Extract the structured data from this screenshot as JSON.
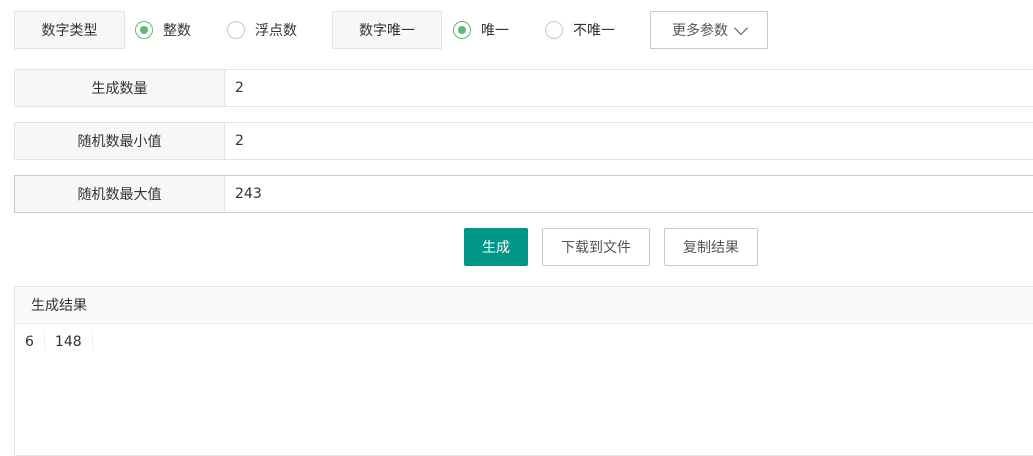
{
  "options": {
    "number_type": {
      "label": "数字类型",
      "choices": [
        {
          "label": "整数",
          "checked": true
        },
        {
          "label": "浮点数",
          "checked": false
        }
      ]
    },
    "unique": {
      "label": "数字唯一",
      "choices": [
        {
          "label": "唯一",
          "checked": true
        },
        {
          "label": "不唯一",
          "checked": false
        }
      ]
    },
    "more_params_label": "更多参数"
  },
  "form": {
    "count": {
      "label": "生成数量",
      "value": "2"
    },
    "min": {
      "label": "随机数最小值",
      "value": "2"
    },
    "max": {
      "label": "随机数最大值",
      "value": "243"
    }
  },
  "actions": {
    "generate_label": "生成",
    "download_label": "下载到文件",
    "copy_label": "复制结果"
  },
  "result": {
    "title": "生成结果",
    "values": [
      "6",
      "148"
    ]
  },
  "colors": {
    "primary": "#009688",
    "radio_checked": "#5fb878"
  }
}
